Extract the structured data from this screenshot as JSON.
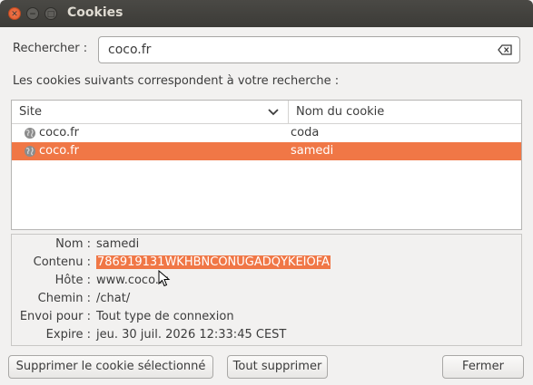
{
  "window": {
    "title": "Cookies"
  },
  "search": {
    "label": "Rechercher :",
    "value": "coco.fr"
  },
  "results_text": "Les cookies suivants correspondent à votre recherche :",
  "table": {
    "columns": [
      "Site",
      "Nom du cookie"
    ],
    "rows": [
      {
        "site": "coco.fr",
        "name": "coda",
        "selected": false
      },
      {
        "site": "coco.fr",
        "name": "samedi",
        "selected": true
      }
    ]
  },
  "details": {
    "name_label": "Nom :",
    "name_value": "samedi",
    "content_label": "Contenu :",
    "content_value": "786919131WKHBNCONUGADQYKEIOFA",
    "host_label": "Hôte :",
    "host_value": "www.coco.fr",
    "path_label": "Chemin :",
    "path_value": "/chat/",
    "send_label": "Envoi pour :",
    "send_value": "Tout type de connexion",
    "expires_label": "Expire :",
    "expires_value": "jeu. 30 juil. 2026 12:33:45 CEST"
  },
  "buttons": {
    "remove_selected": "Supprimer le cookie sélectionné",
    "remove_all": "Tout supprimer",
    "close": "Fermer"
  },
  "colors": {
    "selection": "#f07746",
    "titlebar": "#3c3b37",
    "close_button": "#e25a2b"
  }
}
